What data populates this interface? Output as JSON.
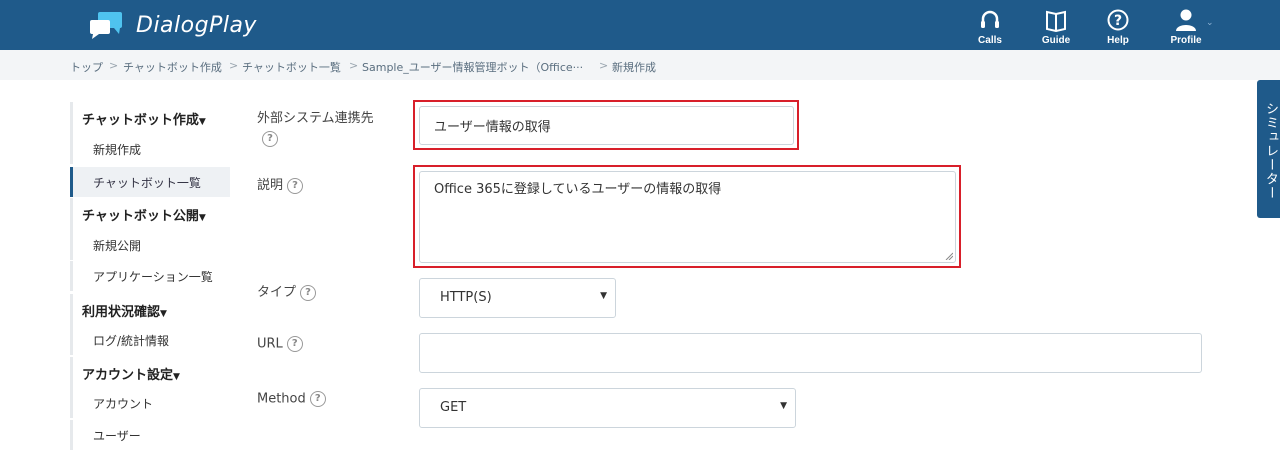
{
  "header": {
    "app_name": "DialogPlay",
    "nav": [
      {
        "label": "Calls",
        "icon": "headset-icon"
      },
      {
        "label": "Guide",
        "icon": "book-icon"
      },
      {
        "label": "Help",
        "icon": "question-circle-icon"
      },
      {
        "label": "Profile",
        "icon": "user-icon"
      }
    ],
    "accent_color": "#1f5a8a"
  },
  "breadcrumb": [
    "トップ",
    "チャットボット作成",
    "チャットボット一覧",
    "Sample_ユーザー情報管理ボット（Office···",
    "新規作成"
  ],
  "sidebar": {
    "sections": [
      {
        "title": "チャットボット作成",
        "items": [
          "新規作成",
          "チャットボット一覧"
        ]
      },
      {
        "title": "チャットボット公開",
        "items": [
          "新規公開",
          "アプリケーション一覧"
        ]
      },
      {
        "title": "利用状況確認",
        "items": [
          "ログ/統計情報"
        ]
      },
      {
        "title": "アカウント設定",
        "items": [
          "アカウント",
          "ユーザー"
        ]
      }
    ],
    "active_item": "チャットボット一覧"
  },
  "form": {
    "external_system": {
      "label": "外部システム連携先",
      "value": "ユーザー情報の取得"
    },
    "description": {
      "label": "説明",
      "value": "Office 365に登録しているユーザーの情報の取得"
    },
    "type": {
      "label": "タイプ",
      "value": "HTTP(S)"
    },
    "url": {
      "label": "URL",
      "value": ""
    },
    "method": {
      "label": "Method",
      "value": "GET"
    },
    "help_glyph": "?"
  },
  "simulator": {
    "label": "シミュレーター"
  },
  "highlight_color": "#d81f2a"
}
